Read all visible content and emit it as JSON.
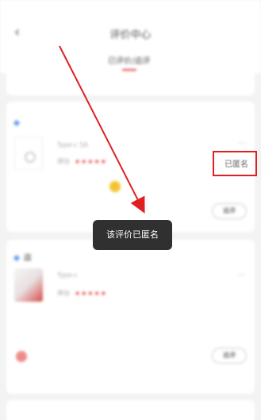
{
  "nav": {
    "title": "评价中心"
  },
  "tabs": [
    {
      "label": "已评价/追评"
    }
  ],
  "review_1": {
    "product_name": "Type-c 5A",
    "rating_label": "评分",
    "stars": "★★★★★",
    "anonymous_label": "已匿名",
    "action_label": "追评"
  },
  "review_2": {
    "shop_name": "店",
    "product_name": "Type-c",
    "rating_label": "评分",
    "stars": "★★★★★",
    "action_label": "追评"
  },
  "toast": {
    "text": "该评价已匿名"
  },
  "colors": {
    "accent": "#e23a3a",
    "highlight": "#e02020",
    "toast_bg": "#1e1e1e"
  }
}
